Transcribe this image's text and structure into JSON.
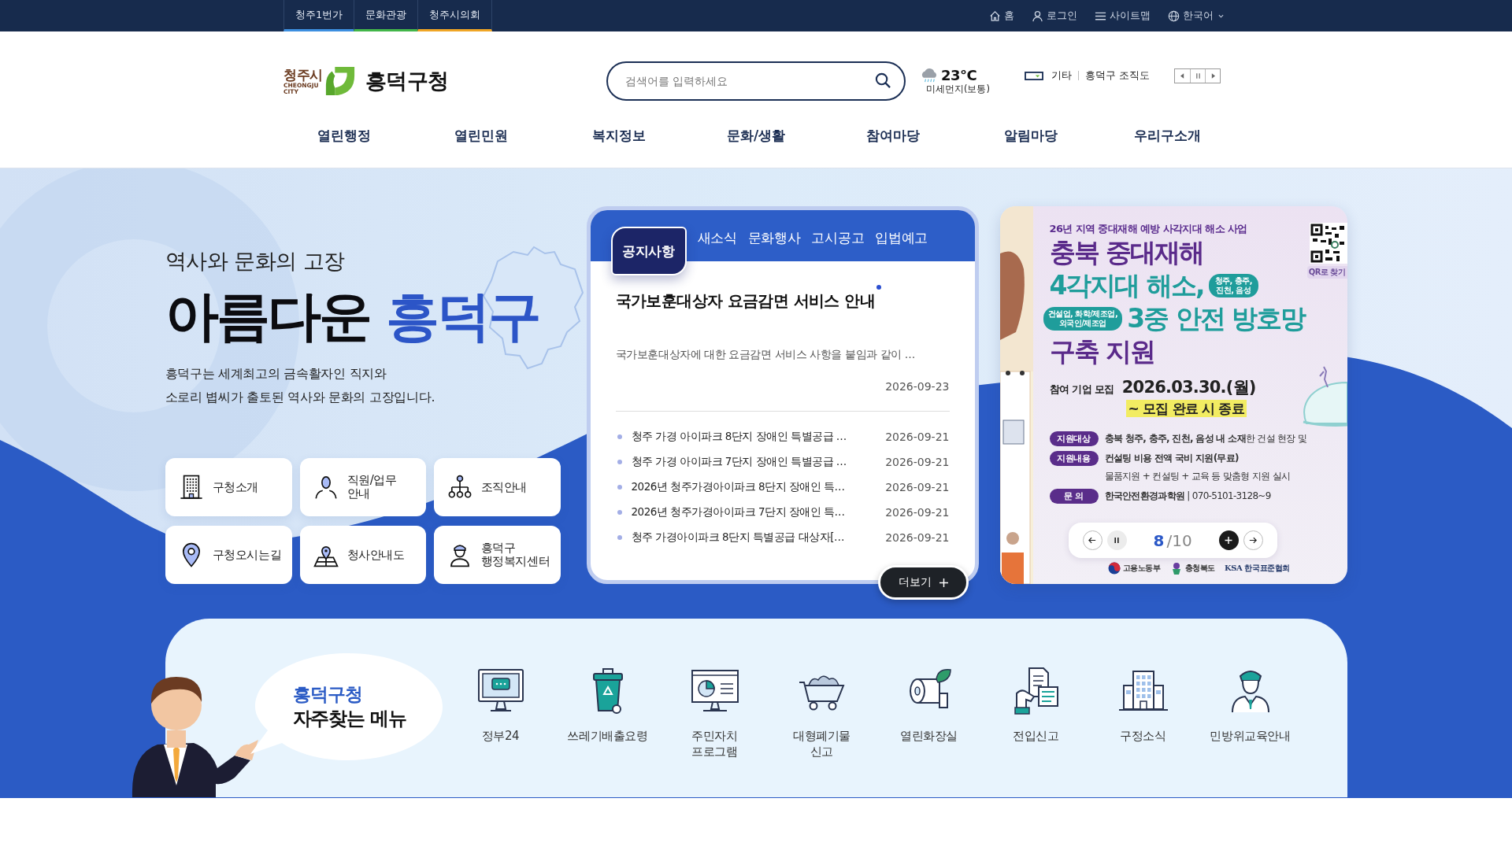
{
  "top_bar": {
    "sites": [
      {
        "label": "청주1번가",
        "color": "#3d8fe0"
      },
      {
        "label": "문화관광",
        "color": "#43b649"
      },
      {
        "label": "청주시의회",
        "color": "#f0a626"
      }
    ],
    "links": [
      {
        "kind": "home",
        "label": "홈"
      },
      {
        "kind": "login",
        "label": "로그인"
      },
      {
        "kind": "sitemap",
        "label": "사이트맵"
      },
      {
        "kind": "language",
        "label": "한국어"
      }
    ]
  },
  "header": {
    "logo": {
      "city": "청주시",
      "city_en": "CHEONGJU\nCITY",
      "office": "흥덕구청"
    },
    "search": {
      "placeholder": "검색어를 입력하세요"
    },
    "weather": {
      "temperature": "23°C",
      "air_quality": "미세먼지(보통)"
    },
    "shortcut": {
      "category": "기타",
      "link": "흥덕구 조직도"
    }
  },
  "nav": [
    "열린행정",
    "열린민원",
    "복지정보",
    "문화/생활",
    "참여마당",
    "알림마당",
    "우리구소개"
  ],
  "hero": {
    "kicker": "역사와 문화의 고장",
    "title_lead": "아름다운",
    "title_highlight": "흥덕구",
    "description": "흥덕구는 세계최고의 금속활자인 직지와\n소로리 볍씨가 출토된 역사와 문화의 고장입니다.",
    "quick_links": [
      {
        "kind": "building",
        "label": "구청소개"
      },
      {
        "kind": "person",
        "label": "직원/업무\n안내"
      },
      {
        "kind": "org",
        "label": "조직안내"
      },
      {
        "kind": "pin",
        "label": "구청오시는길"
      },
      {
        "kind": "map",
        "label": "청사안내도"
      },
      {
        "kind": "staff",
        "label": "흥덕구\n행정복지센터"
      }
    ]
  },
  "notice_board": {
    "tabs": [
      {
        "label": "공지사항",
        "selected": true
      },
      {
        "label": "새소식",
        "selected": false
      },
      {
        "label": "문화행사",
        "selected": false
      },
      {
        "label": "고시공고",
        "selected": false
      },
      {
        "label": "입법예고",
        "selected": false
      }
    ],
    "featured": {
      "title": "국가보훈대상자 요금감면 서비스 안내",
      "new": true,
      "summary": "국가보훈대상자에 대한 요금감면 서비스 사항을 붙임과 같이 …",
      "date": "2026-09-23"
    },
    "items": [
      {
        "title": "청주 가경 아이파크 8단지 장애인 특별공급 …",
        "date": "2026-09-21"
      },
      {
        "title": "청주 가경 아이파크 7단지 장애인 특별공급 …",
        "date": "2026-09-21"
      },
      {
        "title": "2026년 청주가경아이파크 8단지 장애인 특…",
        "date": "2026-09-21"
      },
      {
        "title": "2026년 청주가경아이파크 7단지 장애인 특…",
        "date": "2026-09-21"
      },
      {
        "title": "청주 가경아이파크 8단지 특별공급 대상자[…",
        "date": "2026-09-21"
      }
    ],
    "more_button": "더보기"
  },
  "banner": {
    "poster": {
      "subtitle": "26년 지역 중대재해 예방 사각지대 해소 사업",
      "headline_1": "충북 중대재해",
      "headline_2": "4각지대 해소,",
      "region_bubble": "청주, 충주,\n진천, 음성",
      "industry_bubble": "건설업, 화학/제조업,\n외국인/제조업",
      "headline_3": "3중 안전 방호망",
      "headline_4": "구축 지원",
      "recruit_label": "참여 기업 모집",
      "recruit_date": "2026.03.30.(월)",
      "recruit_end": "~ 모집 완료 시 종료",
      "qr_caption": "QR로 찾기",
      "details": [
        {
          "label": "지원대상",
          "lines": [
            {
              "text": "**충북 청주, 충주, 진천, 음성 내 소재**한 건설 현장 및",
              "bold": false
            }
          ]
        },
        {
          "label": "지원내용",
          "lines": [
            {
              "text": "컨설팅 비용 전액 국비 지원(무료)",
              "bold": true
            },
            {
              "text": "물품지원 + 컨설팅 + 교육 등 맞춤형 지원 실시",
              "bold": false
            }
          ]
        },
        {
          "label": "문 의",
          "lines": [
            {
              "text": "**한국안전환경과학원** | 070-5101-3128~9",
              "bold": false
            }
          ]
        }
      ],
      "sponsors": [
        {
          "kind": "ministry",
          "label": "고용노동부"
        },
        {
          "kind": "province",
          "label": "충청북도"
        },
        {
          "kind": "association",
          "label": "KSA 한국표준협회"
        }
      ]
    },
    "pager": {
      "current": "8",
      "total": "/10"
    }
  },
  "frequent_menu": {
    "heading_top": "흥덕구청",
    "heading_bottom": "자주찾는 메뉴",
    "items": [
      {
        "kind": "monitor",
        "label": "정부24"
      },
      {
        "kind": "bin",
        "label": "쓰레기배출요령"
      },
      {
        "kind": "dashboard",
        "label": "주민자치\n프로그램"
      },
      {
        "kind": "cart",
        "label": "대형폐기물\n신고"
      },
      {
        "kind": "tissue",
        "label": "열린화장실"
      },
      {
        "kind": "document",
        "label": "전입신고"
      },
      {
        "kind": "offices",
        "label": "구정소식"
      },
      {
        "kind": "officer",
        "label": "민방위교육안내"
      }
    ]
  }
}
